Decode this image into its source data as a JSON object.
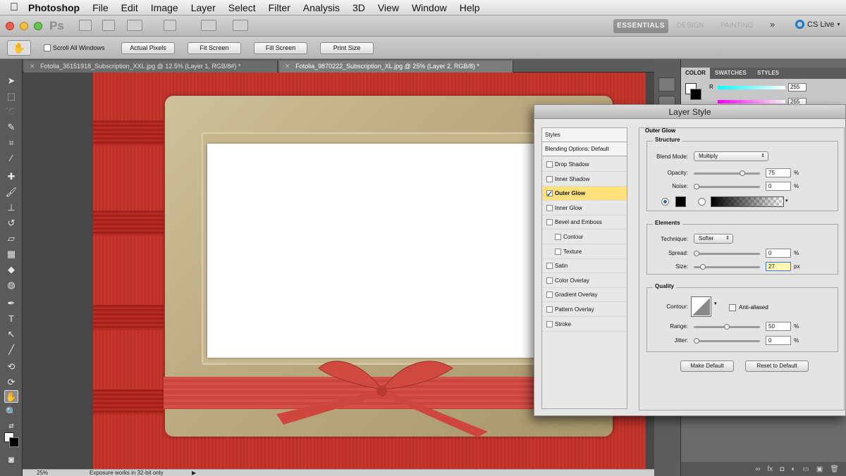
{
  "menubar": {
    "app": "Photoshop",
    "items": [
      "File",
      "Edit",
      "Image",
      "Layer",
      "Select",
      "Filter",
      "Analysis",
      "3D",
      "View",
      "Window",
      "Help"
    ]
  },
  "appbar": {
    "logo": "Ps",
    "workspace": "ESSENTIALS",
    "workspace_faded": [
      "DESIGN",
      "PAINTING"
    ],
    "more": "»",
    "cs_live": "CS Live"
  },
  "options": {
    "scroll_all_windows": "Scroll All Windows",
    "actual_pixels": "Actual Pixels",
    "fit_screen": "Fit Screen",
    "fill_screen": "Fill Screen",
    "print_size": "Print Size"
  },
  "doc_tabs": [
    {
      "title": "Fotolia_36151918_Subscription_XXL.jpg @ 12.5% (Layer 1, RGB/8#) *"
    },
    {
      "title": "Fotolia_9870222_Subscription_XL.jpg @ 25% (Layer 2, RGB/8) *"
    }
  ],
  "status": {
    "zoom": "25%",
    "message": "Exposure works in 32-bit only"
  },
  "right_panel": {
    "tabs": [
      "COLOR",
      "SWATCHES",
      "STYLES"
    ],
    "r_label": "R",
    "r_value": "255",
    "g_value": "255"
  },
  "dialog": {
    "title": "Layer Style",
    "styles_header": "Styles",
    "blending_options": "Blending Options: Default",
    "style_items": [
      {
        "label": "Drop Shadow",
        "checked": false
      },
      {
        "label": "Inner Shadow",
        "checked": false
      },
      {
        "label": "Outer Glow",
        "checked": true
      },
      {
        "label": "Inner Glow",
        "checked": false
      },
      {
        "label": "Bevel and Emboss",
        "checked": false
      },
      {
        "label": "Contour",
        "checked": false
      },
      {
        "label": "Texture",
        "checked": false
      },
      {
        "label": "Satin",
        "checked": false
      },
      {
        "label": "Color Overlay",
        "checked": false
      },
      {
        "label": "Gradient Overlay",
        "checked": false
      },
      {
        "label": "Pattern Overlay",
        "checked": false
      },
      {
        "label": "Stroke",
        "checked": false
      }
    ],
    "section_title": "Outer Glow",
    "structure": {
      "title": "Structure",
      "blend_mode_label": "Blend Mode:",
      "blend_mode_value": "Multiply",
      "opacity_label": "Opacity:",
      "opacity_value": "75",
      "opacity_fraction": 0.75,
      "noise_label": "Noise:",
      "noise_value": "0",
      "noise_fraction": 0,
      "unit": "%"
    },
    "elements": {
      "title": "Elements",
      "technique_label": "Technique:",
      "technique_value": "Softer",
      "spread_label": "Spread:",
      "spread_value": "0",
      "spread_fraction": 0,
      "size_label": "Size:",
      "size_value": "27",
      "size_fraction": 0.11,
      "size_unit": "px",
      "pct_unit": "%"
    },
    "quality": {
      "title": "Quality",
      "contour_label": "Contour:",
      "anti_aliased": "Anti-aliased",
      "range_label": "Range:",
      "range_value": "50",
      "range_fraction": 0.5,
      "jitter_label": "Jitter:",
      "jitter_value": "0",
      "jitter_fraction": 0,
      "unit": "%"
    },
    "make_default": "Make Default",
    "reset_to_default": "Reset to Default"
  },
  "colors": {
    "highlight": "#ffe07a",
    "accent_blue": "#2d62c7"
  }
}
